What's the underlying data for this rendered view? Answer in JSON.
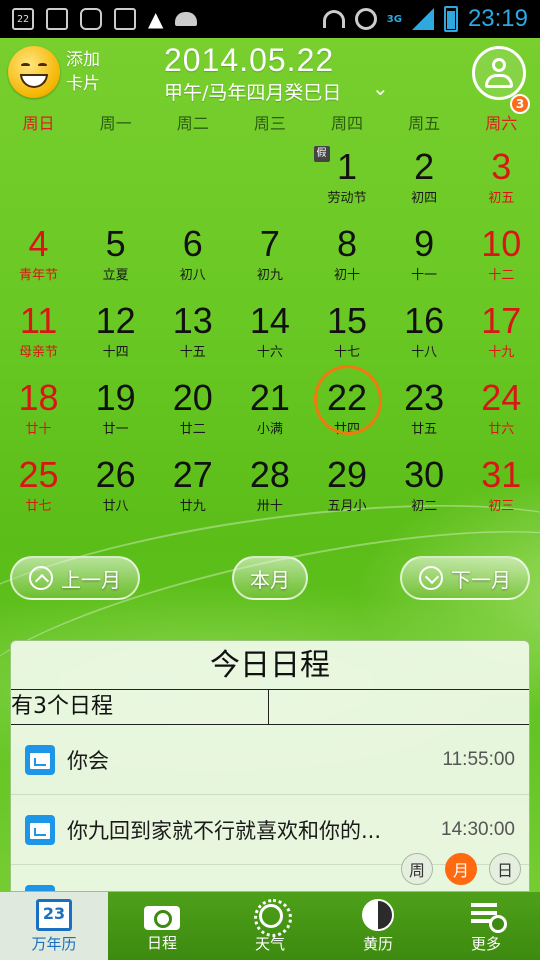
{
  "statusbar": {
    "time": "23:19",
    "network": "3G",
    "left_icons": [
      "calendar-22-icon",
      "news-icon",
      "sync-icon",
      "photo-icon",
      "warning-icon",
      "android-icon"
    ],
    "notif_label": "22",
    "warning_glyph": "▲"
  },
  "header": {
    "add_card_line1": "添加",
    "add_card_line2": "卡片",
    "date": "2014.05.22",
    "lunar": "甲午/马年四月癸巳日",
    "chevron": "⌄",
    "badge": "3"
  },
  "weekdays": [
    "周日",
    "周一",
    "周二",
    "周三",
    "周四",
    "周五",
    "周六"
  ],
  "calendar": {
    "month": "2014-05",
    "today": "22",
    "holiday_tag": "假",
    "weeks": [
      [
        {
          "num": "",
          "sub": ""
        },
        {
          "num": "",
          "sub": ""
        },
        {
          "num": "",
          "sub": ""
        },
        {
          "num": "",
          "sub": ""
        },
        {
          "num": "1",
          "sub": "劳动节"
        },
        {
          "num": "2",
          "sub": "初四"
        },
        {
          "num": "3",
          "sub": "初五"
        }
      ],
      [
        {
          "num": "4",
          "sub": "青年节"
        },
        {
          "num": "5",
          "sub": "立夏"
        },
        {
          "num": "6",
          "sub": "初八"
        },
        {
          "num": "7",
          "sub": "初九"
        },
        {
          "num": "8",
          "sub": "初十"
        },
        {
          "num": "9",
          "sub": "十一"
        },
        {
          "num": "10",
          "sub": "十二"
        }
      ],
      [
        {
          "num": "11",
          "sub": "母亲节"
        },
        {
          "num": "12",
          "sub": "十四"
        },
        {
          "num": "13",
          "sub": "十五"
        },
        {
          "num": "14",
          "sub": "十六"
        },
        {
          "num": "15",
          "sub": "十七"
        },
        {
          "num": "16",
          "sub": "十八"
        },
        {
          "num": "17",
          "sub": "十九"
        }
      ],
      [
        {
          "num": "18",
          "sub": "廿十"
        },
        {
          "num": "19",
          "sub": "廿一"
        },
        {
          "num": "20",
          "sub": "廿二"
        },
        {
          "num": "21",
          "sub": "小满"
        },
        {
          "num": "22",
          "sub": "廿四"
        },
        {
          "num": "23",
          "sub": "廿五"
        },
        {
          "num": "24",
          "sub": "廿六"
        }
      ],
      [
        {
          "num": "25",
          "sub": "廿七"
        },
        {
          "num": "26",
          "sub": "廿八"
        },
        {
          "num": "27",
          "sub": "廿九"
        },
        {
          "num": "28",
          "sub": "卅十"
        },
        {
          "num": "29",
          "sub": "五月小"
        },
        {
          "num": "30",
          "sub": "初二"
        },
        {
          "num": "31",
          "sub": "初三"
        }
      ]
    ]
  },
  "nav": {
    "prev": "上一月",
    "current": "本月",
    "next": "下一月"
  },
  "schedule": {
    "title": "今日日程",
    "count": "有3个日程",
    "items": [
      {
        "title": "你会",
        "time": "11:55:00"
      },
      {
        "title": "你九回到家就不行就喜欢和你的...",
        "time": "14:30:00"
      }
    ],
    "view_modes": [
      "周",
      "月",
      "日"
    ],
    "active_view": "月"
  },
  "tabs": [
    {
      "label": "万年历",
      "icon": "calendar-icon",
      "icon_text": "23"
    },
    {
      "label": "日程",
      "icon": "camera-icon"
    },
    {
      "label": "天气",
      "icon": "sun-icon"
    },
    {
      "label": "黄历",
      "icon": "yinyang-icon"
    },
    {
      "label": "更多",
      "icon": "more-icon"
    }
  ],
  "colors": {
    "accent_orange": "#f07a10",
    "weekend_red": "#d91515",
    "tab_active_blue": "#1b6fc0",
    "clock_blue": "#2fa8e0"
  }
}
